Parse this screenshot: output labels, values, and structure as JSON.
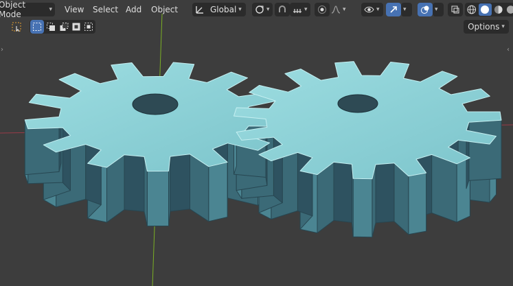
{
  "header": {
    "mode_label": "Object Mode",
    "menus": [
      "View",
      "Select",
      "Add",
      "Object"
    ],
    "transform_orientation": "Global",
    "options_label": "Options"
  },
  "icons": {
    "select_box": "select-box-icon",
    "orientation": "transform-orientation-icon",
    "pivot": "pivot-point-icon",
    "snap": "snap-magnet-icon",
    "snap_target": "snap-increment-icon",
    "proportional": "proportional-editing-icon",
    "falloff": "falloff-curve-icon",
    "visibility": "eye-icon",
    "gizmo": "gizmo-arrow-icon",
    "overlay": "overlay-icon",
    "xray": "xray-icon",
    "shading": [
      "wireframe-shading-icon",
      "solid-shading-icon",
      "material-shading-icon",
      "rendered-shading-icon"
    ]
  },
  "colors": {
    "background": "#3d3d3d",
    "gear_top": "#8fd3d8",
    "gear_side": "#3f6b78",
    "axis_x": "#9a3b48",
    "axis_y": "#7bb024",
    "active_button": "#4772b3"
  }
}
